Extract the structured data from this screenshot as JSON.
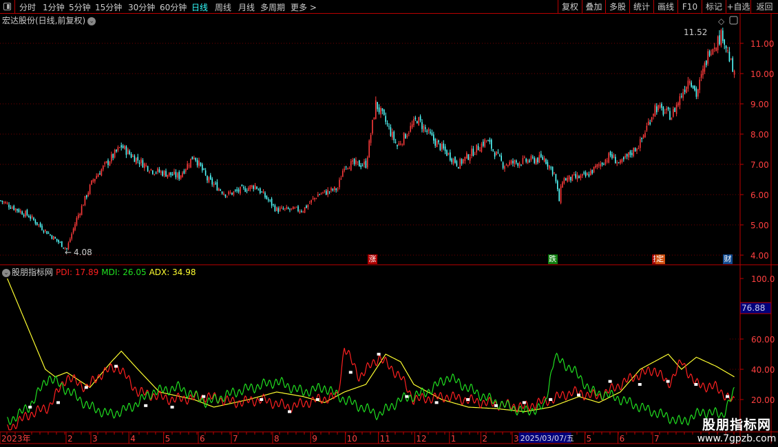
{
  "toolbar": {
    "periods": [
      "分时",
      "1分钟",
      "5分钟",
      "15分钟",
      "30分钟",
      "60分钟",
      "日线",
      "周线",
      "月线",
      "多周期",
      "更多 >"
    ],
    "active_period": "日线",
    "right_buttons": [
      "复权",
      "叠加",
      "多股",
      "统计",
      "画线",
      "F10",
      "标记",
      "+自选",
      "返回"
    ]
  },
  "main_title": "宏达股份(日线,前复权)",
  "high_label": "11.52",
  "low_label": "4.08",
  "markers": [
    {
      "text": "涨",
      "color": "#b00000",
      "day": 225
    },
    {
      "text": "跌",
      "color": "#108010",
      "day": 334
    },
    {
      "text": "提",
      "color": "#a00000",
      "day": 397
    },
    {
      "text": "定",
      "color": "#d05010",
      "day": 399
    },
    {
      "text": "财",
      "color": "#104a90",
      "day": 440
    }
  ],
  "indicator": {
    "name": "股朋指标网",
    "pdi_label": "PDI: 17.89",
    "mdi_label": "MDI: 26.05",
    "adx_label": "ADX: 34.98",
    "cursor_value": "76.88"
  },
  "colors": {
    "up": "#ff3b3b",
    "down": "#54ffff",
    "pdi": "#ff2020",
    "mdi": "#20e020",
    "adx": "#ffff30",
    "axis": "#c00000"
  },
  "x_axis": {
    "labels": [
      {
        "t": "2023年",
        "day": 0
      },
      {
        "t": "2",
        "day": 40
      },
      {
        "t": "3",
        "day": 55
      },
      {
        "t": "4",
        "day": 78
      },
      {
        "t": "5",
        "day": 99
      },
      {
        "t": "6",
        "day": 120
      },
      {
        "t": "7",
        "day": 140
      },
      {
        "t": "8",
        "day": 165
      },
      {
        "t": "9",
        "day": 188
      },
      {
        "t": "10",
        "day": 209
      },
      {
        "t": "11",
        "day": 229
      },
      {
        "t": "12",
        "day": 251
      },
      {
        "t": "1",
        "day": 272
      },
      {
        "t": "2",
        "day": 291
      },
      {
        "t": "3",
        "day": 310
      },
      {
        "t": "5",
        "day": 354
      },
      {
        "t": "6",
        "day": 374
      },
      {
        "t": "7",
        "day": 395
      }
    ],
    "cursor_label": "2025/03/07/五",
    "cursor_day": 314
  },
  "watermark": {
    "line1": "股朋指标网",
    "line2": "www.7gpzb.com"
  },
  "chart_data": [
    {
      "type": "candlestick",
      "title": "宏达股份",
      "y_ticks": [
        "11.00",
        "10.00",
        "9.00",
        "8.00",
        "7.00",
        "6.00",
        "5.00",
        "4.00"
      ],
      "ylim": [
        3.7,
        12.3
      ],
      "close_keypoints": [
        [
          0,
          5.8
        ],
        [
          17,
          5.3
        ],
        [
          25,
          4.9
        ],
        [
          40,
          4.2
        ],
        [
          46,
          5.2
        ],
        [
          56,
          6.5
        ],
        [
          73,
          7.6
        ],
        [
          79,
          7.3
        ],
        [
          92,
          6.8
        ],
        [
          108,
          6.6
        ],
        [
          117,
          7.3
        ],
        [
          125,
          6.5
        ],
        [
          137,
          6.0
        ],
        [
          154,
          6.3
        ],
        [
          167,
          5.5
        ],
        [
          183,
          5.5
        ],
        [
          192,
          6.0
        ],
        [
          204,
          6.2
        ],
        [
          208,
          7.0
        ],
        [
          221,
          7.0
        ],
        [
          227,
          9.0
        ],
        [
          233,
          8.4
        ],
        [
          240,
          7.6
        ],
        [
          252,
          8.5
        ],
        [
          262,
          7.8
        ],
        [
          277,
          7.0
        ],
        [
          294,
          7.8
        ],
        [
          304,
          7.0
        ],
        [
          329,
          7.2
        ],
        [
          335,
          6.7
        ],
        [
          338,
          5.8
        ],
        [
          340,
          6.5
        ],
        [
          354,
          6.6
        ],
        [
          369,
          7.3
        ],
        [
          375,
          7.0
        ],
        [
          387,
          7.7
        ],
        [
          396,
          8.9
        ],
        [
          406,
          8.6
        ],
        [
          417,
          9.9
        ],
        [
          421,
          9.3
        ],
        [
          429,
          10.8
        ],
        [
          437,
          11.3
        ],
        [
          440,
          10.7
        ],
        [
          444,
          9.9
        ]
      ]
    },
    {
      "type": "line",
      "title": "股朋指标网",
      "y_ticks": [
        "100.0",
        "60.00",
        "40.00",
        "20.00"
      ],
      "ylim": [
        0,
        100
      ],
      "series": [
        {
          "name": "ADX",
          "points": [
            [
              4,
              100
            ],
            [
              27,
              40
            ],
            [
              33,
              35
            ],
            [
              40,
              38
            ],
            [
              54,
              28
            ],
            [
              67,
              45
            ],
            [
              73,
              52
            ],
            [
              83,
              40
            ],
            [
              96,
              25
            ],
            [
              117,
              20
            ],
            [
              129,
              15
            ],
            [
              150,
              20
            ],
            [
              167,
              25
            ],
            [
              183,
              22
            ],
            [
              196,
              18
            ],
            [
              208,
              25
            ],
            [
              221,
              30
            ],
            [
              233,
              50
            ],
            [
              242,
              45
            ],
            [
              250,
              30
            ],
            [
              267,
              20
            ],
            [
              283,
              15
            ],
            [
              300,
              14
            ],
            [
              317,
              12
            ],
            [
              333,
              15
            ],
            [
              350,
              22
            ],
            [
              362,
              18
            ],
            [
              375,
              25
            ],
            [
              387,
              40
            ],
            [
              404,
              50
            ],
            [
              412,
              40
            ],
            [
              421,
              48
            ],
            [
              433,
              42
            ],
            [
              444,
              35
            ]
          ]
        },
        {
          "name": "PDI",
          "points": [
            [
              4,
              0
            ],
            [
              17,
              10
            ],
            [
              29,
              15
            ],
            [
              40,
              35
            ],
            [
              52,
              28
            ],
            [
              62,
              38
            ],
            [
              71,
              42
            ],
            [
              83,
              25
            ],
            [
              104,
              20
            ],
            [
              125,
              22
            ],
            [
              142,
              18
            ],
            [
              158,
              20
            ],
            [
              175,
              15
            ],
            [
              192,
              20
            ],
            [
              204,
              22
            ],
            [
              208,
              55
            ],
            [
              217,
              35
            ],
            [
              229,
              48
            ],
            [
              242,
              35
            ],
            [
              250,
              20
            ],
            [
              271,
              22
            ],
            [
              292,
              18
            ],
            [
              317,
              15
            ],
            [
              333,
              20
            ],
            [
              346,
              25
            ],
            [
              362,
              22
            ],
            [
              375,
              30
            ],
            [
              383,
              35
            ],
            [
              396,
              40
            ],
            [
              404,
              30
            ],
            [
              412,
              45
            ],
            [
              421,
              30
            ],
            [
              433,
              28
            ],
            [
              444,
              18
            ]
          ]
        },
        {
          "name": "MDI",
          "points": [
            [
              4,
              5
            ],
            [
              17,
              15
            ],
            [
              29,
              35
            ],
            [
              42,
              25
            ],
            [
              54,
              15
            ],
            [
              67,
              10
            ],
            [
              79,
              15
            ],
            [
              92,
              25
            ],
            [
              108,
              28
            ],
            [
              125,
              18
            ],
            [
              142,
              25
            ],
            [
              167,
              32
            ],
            [
              183,
              25
            ],
            [
              196,
              28
            ],
            [
              208,
              20
            ],
            [
              229,
              10
            ],
            [
              242,
              20
            ],
            [
              258,
              25
            ],
            [
              271,
              35
            ],
            [
              287,
              25
            ],
            [
              300,
              18
            ],
            [
              317,
              12
            ],
            [
              329,
              15
            ],
            [
              335,
              48
            ],
            [
              346,
              40
            ],
            [
              358,
              25
            ],
            [
              371,
              22
            ],
            [
              387,
              15
            ],
            [
              400,
              10
            ],
            [
              412,
              5
            ],
            [
              425,
              12
            ],
            [
              437,
              10
            ],
            [
              444,
              25
            ]
          ]
        }
      ]
    }
  ]
}
